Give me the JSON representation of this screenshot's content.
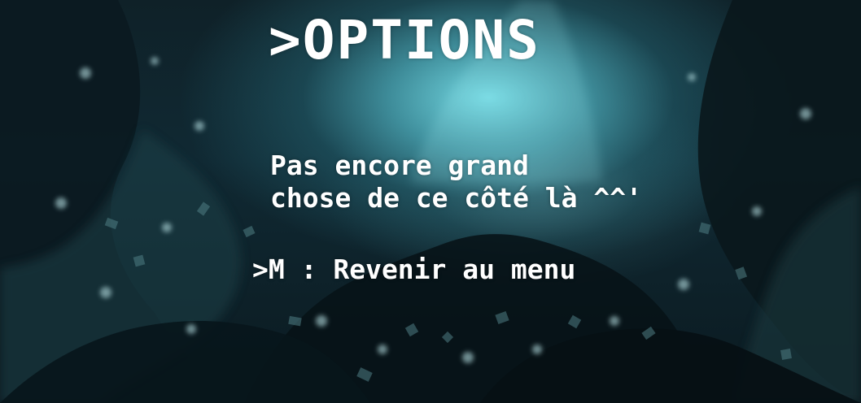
{
  "screen": {
    "title": ">OPTIONS",
    "message_line_1": "Pas encore grand",
    "message_line_2": "chose de ce côté là ^^'",
    "menu_option": ">M : Revenir au menu"
  },
  "colors": {
    "background": "#0d1c22",
    "light": "#7ee1eb",
    "text": "#ffffff"
  }
}
